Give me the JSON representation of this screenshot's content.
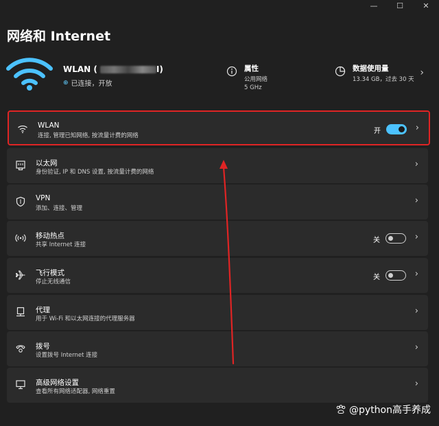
{
  "window": {
    "controls": {
      "minimize": "—",
      "maximize": "☐",
      "close": "✕"
    }
  },
  "page_title": "网络和 Internet",
  "header": {
    "network_name": "WLAN (",
    "network_name_end": "I)",
    "status": "已连接，开放",
    "properties": {
      "title": "属性",
      "line1": "公用网络",
      "line2": "5 GHz"
    },
    "usage": {
      "title": "数据使用量",
      "line1": "13.34 GB，过去 30 天"
    }
  },
  "items": [
    {
      "title": "WLAN",
      "subtitle": "连接, 管理已知网络, 按流量计费的网络",
      "toggle_label": "开",
      "toggle": "on",
      "icon": "wifi-icon"
    },
    {
      "title": "以太网",
      "subtitle": "身份验证, IP 和 DNS 设置, 按流量计费的网络",
      "icon": "ethernet-icon"
    },
    {
      "title": "VPN",
      "subtitle": "添加、连接、管理",
      "icon": "shield-icon"
    },
    {
      "title": "移动热点",
      "subtitle": "共享 Internet 连接",
      "toggle_label": "关",
      "toggle": "off",
      "icon": "hotspot-icon"
    },
    {
      "title": "飞行模式",
      "subtitle": "停止无线通信",
      "toggle_label": "关",
      "toggle": "off",
      "icon": "airplane-icon"
    },
    {
      "title": "代理",
      "subtitle": "用于 Wi-Fi 和以太网连接的代理服务器",
      "icon": "proxy-icon"
    },
    {
      "title": "拨号",
      "subtitle": "设置拨号 Internet 连接",
      "icon": "dialup-icon"
    },
    {
      "title": "高级网络设置",
      "subtitle": "查看所有网络适配器, 网络重置",
      "icon": "advanced-network-icon"
    }
  ],
  "watermark": "@python高手养成",
  "colors": {
    "accent": "#4cc2ff",
    "highlight_border": "#e02424",
    "arrow": "#e02424"
  }
}
